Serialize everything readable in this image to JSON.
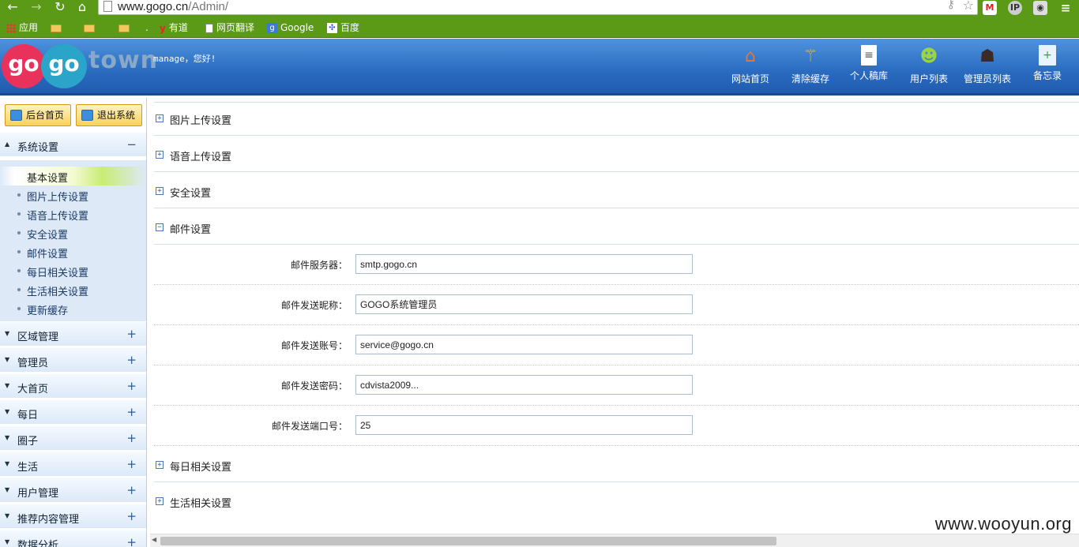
{
  "browser": {
    "url_host": "www.gogo.cn",
    "url_path": "/Admin/",
    "bookmarks": [
      {
        "label": "应用"
      },
      {
        "label": ""
      },
      {
        "label": ""
      },
      {
        "label": ""
      },
      {
        "label": "."
      },
      {
        "label": "有道"
      },
      {
        "label": "网页翻译"
      },
      {
        "label": "Google"
      },
      {
        "label": "百度"
      }
    ]
  },
  "header": {
    "logo_go1": "go",
    "logo_go2": "go",
    "logo_town": "town",
    "greeting": "manage，您好!",
    "nav": [
      {
        "label": "网站首页",
        "icon": "home-icon"
      },
      {
        "label": "清除缓存",
        "icon": "broom-icon"
      },
      {
        "label": "个人稿库",
        "icon": "document-icon"
      },
      {
        "label": "用户列表",
        "icon": "users-icon"
      },
      {
        "label": "管理员列表",
        "icon": "admin-icon"
      },
      {
        "label": "备忘录",
        "icon": "memo-icon"
      }
    ]
  },
  "sidebar": {
    "home_button": "后台首页",
    "logout_button": "退出系统",
    "sections": [
      {
        "label": "系统设置",
        "expanded": true
      },
      {
        "label": "区域管理"
      },
      {
        "label": "管理员"
      },
      {
        "label": "大首页"
      },
      {
        "label": "每日"
      },
      {
        "label": "圈子"
      },
      {
        "label": "生活"
      },
      {
        "label": "用户管理"
      },
      {
        "label": "推荐内容管理"
      },
      {
        "label": "数据分析"
      }
    ],
    "system_items": [
      {
        "label": "基本设置",
        "active": true
      },
      {
        "label": "图片上传设置"
      },
      {
        "label": "语音上传设置"
      },
      {
        "label": "安全设置"
      },
      {
        "label": "邮件设置"
      },
      {
        "label": "每日相关设置"
      },
      {
        "label": "生活相关设置"
      },
      {
        "label": "更新缓存"
      }
    ],
    "collapse_symbol": "−",
    "expand_symbol": "+"
  },
  "main": {
    "panels_before": [
      {
        "label": "图片上传设置",
        "expanded": false
      },
      {
        "label": "语音上传设置",
        "expanded": false
      },
      {
        "label": "安全设置",
        "expanded": false
      }
    ],
    "mail_panel": {
      "label": "邮件设置",
      "expanded": true,
      "fields": [
        {
          "label": "邮件服务器：",
          "value": "smtp.gogo.cn"
        },
        {
          "label": "邮件发送昵称：",
          "value": "GOGO系统管理员"
        },
        {
          "label": "邮件发送账号：",
          "value": "service@gogo.cn"
        },
        {
          "label": "邮件发送密码：",
          "value": "cdvista2009..."
        },
        {
          "label": "邮件发送端口号：",
          "value": "25"
        }
      ]
    },
    "panels_after": [
      {
        "label": "每日相关设置",
        "expanded": false
      },
      {
        "label": "生活相关设置",
        "expanded": false
      }
    ]
  },
  "watermark": "www.wooyun.org"
}
